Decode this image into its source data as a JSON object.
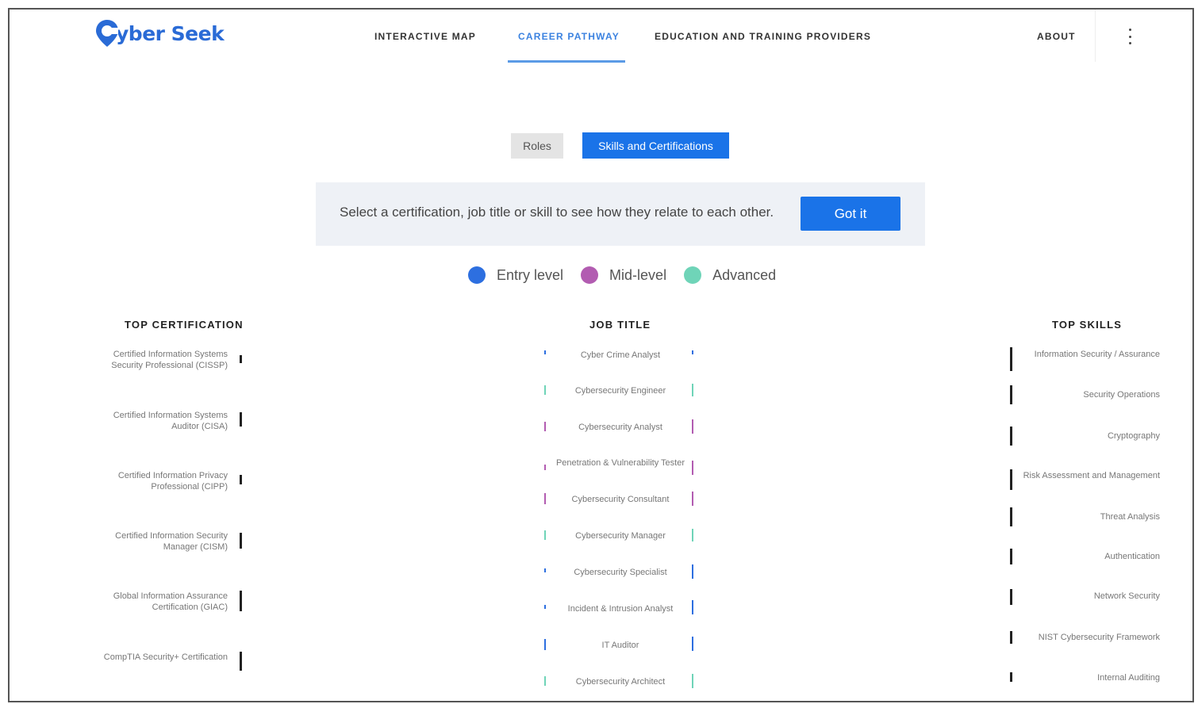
{
  "brand": {
    "name": "yber Seek",
    "logo_letter": "C"
  },
  "nav": {
    "interactive_map": "INTERACTIVE MAP",
    "career_pathway": "CAREER PATHWAY",
    "education": "EDUCATION AND TRAINING PROVIDERS",
    "about": "ABOUT"
  },
  "toggle": {
    "roles": "Roles",
    "skills": "Skills and Certifications"
  },
  "banner": {
    "text": "Select a certification, job title or skill to see how they relate to each other.",
    "button": "Got it"
  },
  "legend": [
    {
      "label": "Entry level",
      "color": "#2d6fe0"
    },
    {
      "label": "Mid-level",
      "color": "#b25cb1"
    },
    {
      "label": "Advanced",
      "color": "#6fd4b8"
    }
  ],
  "columns": {
    "certifications_title": "TOP CERTIFICATION",
    "jobs_title": "JOB TITLE",
    "skills_title": "TOP SKILLS"
  },
  "certifications": [
    "Certified Information Systems Security Professional (CISSP)",
    "Certified Information Systems Auditor (CISA)",
    "Certified Information Privacy Professional (CIPP)",
    "Certified Information Security Manager (CISM)",
    "Global Information Assurance Certification (GIAC)",
    "CompTIA Security+ Certification"
  ],
  "jobs": [
    {
      "title": "Cyber Crime Analyst",
      "level": "entry"
    },
    {
      "title": "Cybersecurity Engineer",
      "level": "advanced"
    },
    {
      "title": "Cybersecurity Analyst",
      "level": "mid"
    },
    {
      "title": "Penetration & Vulnerability Tester",
      "level": "mid"
    },
    {
      "title": "Cybersecurity Consultant",
      "level": "mid"
    },
    {
      "title": "Cybersecurity Manager",
      "level": "advanced"
    },
    {
      "title": "Cybersecurity Specialist",
      "level": "entry"
    },
    {
      "title": "Incident & Intrusion Analyst",
      "level": "entry"
    },
    {
      "title": "IT Auditor",
      "level": "entry"
    },
    {
      "title": "Cybersecurity Architect",
      "level": "advanced"
    }
  ],
  "skills": [
    "Information Security / Assurance",
    "Security Operations",
    "Cryptography",
    "Risk Assessment and Management",
    "Threat Analysis",
    "Authentication",
    "Network Security",
    "NIST Cybersecurity Framework",
    "Internal Auditing"
  ]
}
